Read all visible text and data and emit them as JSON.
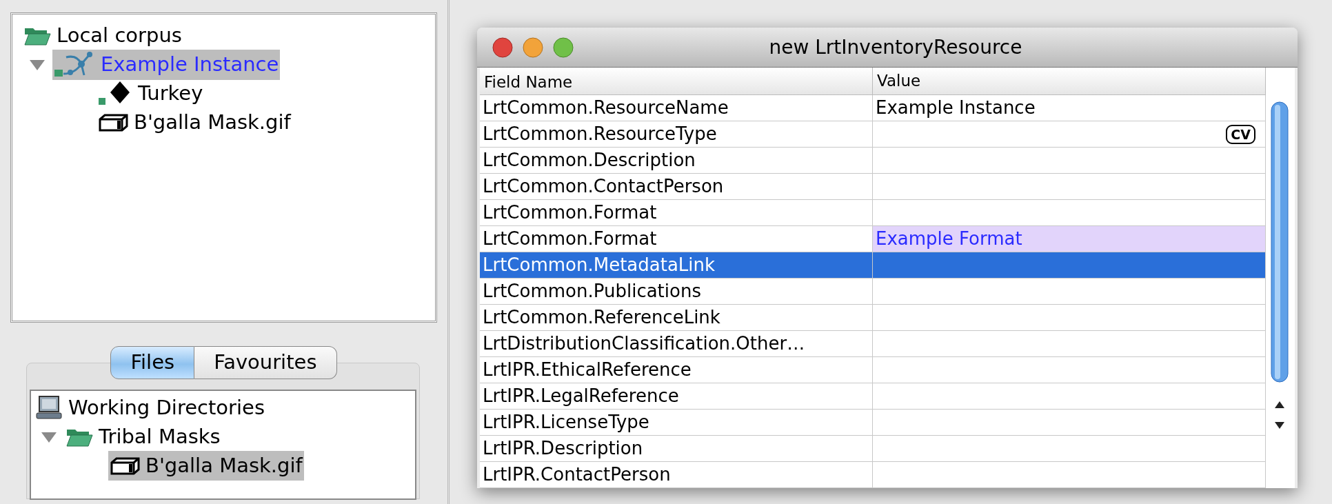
{
  "corpus_tree": [
    {
      "label": "Local corpus",
      "kind": "folder",
      "selected": false,
      "children": [
        {
          "label": "Example Instance",
          "kind": "instance",
          "selected": true,
          "expanded": true,
          "children": [
            {
              "label": "Turkey",
              "kind": "node",
              "selected": false
            },
            {
              "label": "B'galla Mask.gif",
              "kind": "file",
              "selected": false
            }
          ]
        }
      ]
    }
  ],
  "tabs": [
    {
      "label": "Files",
      "selected": true
    },
    {
      "label": "Favourites",
      "selected": false
    }
  ],
  "files_tree": [
    {
      "label": "Working Directories",
      "kind": "computer",
      "selected": false,
      "children": [
        {
          "label": "Tribal Masks",
          "kind": "folder",
          "selected": false,
          "expanded": true,
          "children": [
            {
              "label": "B'galla Mask.gif",
              "kind": "file",
              "selected": true
            }
          ]
        }
      ]
    }
  ],
  "dialog": {
    "title": "new LrtInventoryResource",
    "columns": [
      "Field Name",
      "Value"
    ],
    "rows": [
      {
        "field": "LrtCommon.ResourceName",
        "value": "Example Instance",
        "selected": false,
        "highlighted": false
      },
      {
        "field": "LrtCommon.ResourceType",
        "badge": "CV",
        "selected": false,
        "highlighted": false
      },
      {
        "field": "LrtCommon.Description",
        "selected": false,
        "highlighted": false
      },
      {
        "field": "LrtCommon.ContactPerson",
        "selected": false,
        "highlighted": false
      },
      {
        "field": "LrtCommon.Format",
        "selected": false,
        "highlighted": false
      },
      {
        "field": "LrtCommon.Format",
        "value": "Example Format",
        "selected": false,
        "highlighted": true
      },
      {
        "field": "LrtCommon.MetadataLink",
        "selected": true,
        "highlighted": false
      },
      {
        "field": "LrtCommon.Publications",
        "selected": false,
        "highlighted": false
      },
      {
        "field": "LrtCommon.ReferenceLink",
        "selected": false,
        "highlighted": false
      },
      {
        "field": "LrtDistributionClassification.Other…",
        "selected": false,
        "highlighted": false
      },
      {
        "field": "LrtIPR.EthicalReference",
        "selected": false,
        "highlighted": false
      },
      {
        "field": "LrtIPR.LegalReference",
        "selected": false,
        "highlighted": false
      },
      {
        "field": "LrtIPR.LicenseType",
        "selected": false,
        "highlighted": false
      },
      {
        "field": "LrtIPR.Description",
        "selected": false,
        "highlighted": false
      },
      {
        "field": "LrtIPR.ContactPerson",
        "selected": false,
        "highlighted": false
      }
    ]
  }
}
